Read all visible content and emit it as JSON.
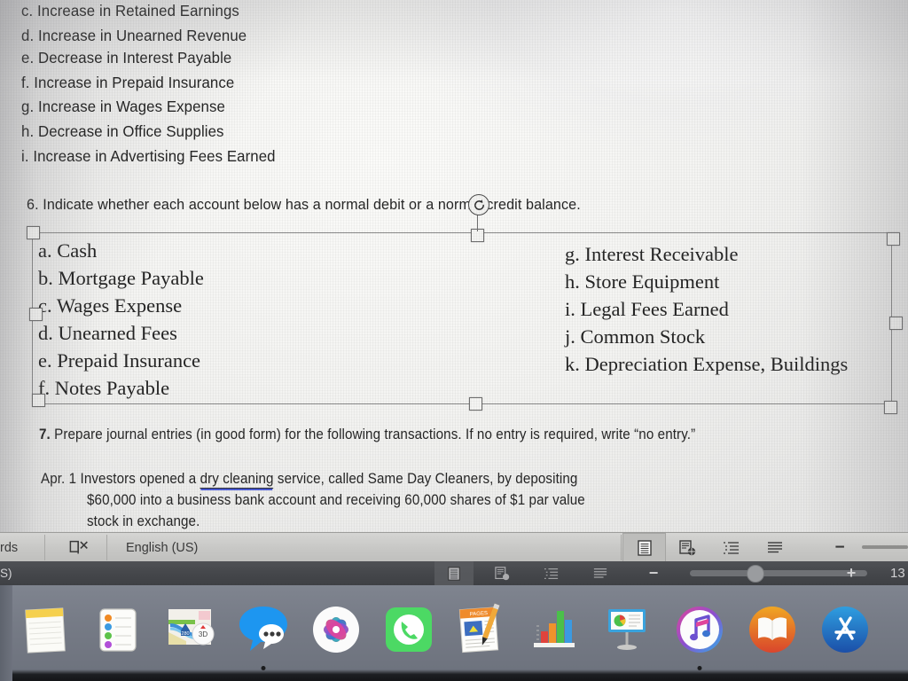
{
  "document": {
    "list_items": [
      "c. Increase in Retained Earnings",
      "d. Increase in Unearned Revenue",
      "e. Decrease in Interest Payable",
      "f. Increase in Prepaid Insurance",
      "g. Increase in Wages Expense",
      "h. Decrease in Office Supplies",
      "i. Increase in Advertising Fees Earned"
    ],
    "question6": "6. Indicate whether each account below has a normal debit or a normal credit balance.",
    "textbox": {
      "left_column": [
        "a. Cash",
        "b. Mortgage Payable",
        "c. Wages Expense",
        "d. Unearned Fees",
        "e. Prepaid Insurance",
        "f. Notes Payable"
      ],
      "right_column": [
        "g. Interest Receivable",
        "h. Store Equipment",
        "i. Legal Fees Earned",
        "j. Common Stock",
        "k. Depreciation Expense, Buildings"
      ]
    },
    "question7": {
      "number": "7.",
      "text": " Prepare journal entries (in good form) for the following transactions. If no entry is required, write “no entry.”"
    },
    "transaction": {
      "line1_pre": "Apr. 1 Investors opened a ",
      "line1_spell": "dry cleaning",
      "line1_post": " service, called Same Day Cleaners, by depositing",
      "line2": "$60,000 into a business bank account and receiving 60,000 shares of $1 par value",
      "line3": "stock in exchange."
    }
  },
  "statusbar": {
    "words_label": "rds",
    "proofing_icon": "book-x-icon",
    "language": "English (US)",
    "views": [
      {
        "name": "print-layout-view",
        "active": true
      },
      {
        "name": "web-layout-view",
        "active": false
      },
      {
        "name": "outline-view",
        "active": false
      },
      {
        "name": "draft-view",
        "active": false
      }
    ],
    "zoom_out_label": "−",
    "zoom_in_label": "+"
  },
  "statusbar_secondary": {
    "language_fragment": "S)",
    "zoom_out_label": "−",
    "zoom_in_label": "+",
    "zoom_percent": "13"
  },
  "dock": {
    "items": [
      {
        "name": "dock-item-notes",
        "label": "Notes"
      },
      {
        "name": "dock-item-reminders",
        "label": "Reminders"
      },
      {
        "name": "dock-item-maps",
        "label": "Maps"
      },
      {
        "name": "dock-item-messages",
        "label": "Messages"
      },
      {
        "name": "dock-item-photos",
        "label": "Photos"
      },
      {
        "name": "dock-item-facetime",
        "label": "FaceTime"
      },
      {
        "name": "dock-item-pages",
        "label": "Pages"
      },
      {
        "name": "dock-item-numbers",
        "label": "Numbers"
      },
      {
        "name": "dock-item-keynote",
        "label": "Keynote"
      },
      {
        "name": "dock-item-itunes",
        "label": "iTunes"
      },
      {
        "name": "dock-item-ibooks",
        "label": "iBooks"
      },
      {
        "name": "dock-item-appstore",
        "label": "App Store"
      }
    ]
  },
  "selection": {
    "rotate_handle": "rotate-icon",
    "handle_count": 8
  },
  "colors": {
    "page_bg": "#f1f1ef",
    "text": "#262626",
    "spellcheck": "#4a5bd4",
    "handle_fill": "#f4f4f2",
    "handle_stroke": "#6f6f6f",
    "dock_bg": "#767b86",
    "statusbar_bg": "#c7c7c5"
  }
}
